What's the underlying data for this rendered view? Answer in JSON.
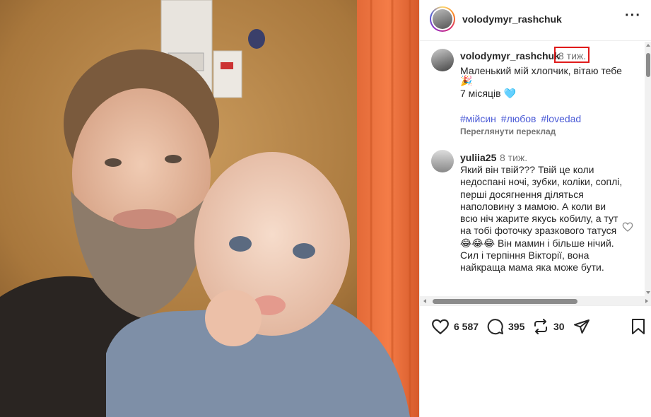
{
  "post": {
    "username": "volodymyr_rashchuk",
    "more_icon": "more-horizontal-icon"
  },
  "caption": {
    "username": "volodymyr_rashchuk",
    "time": "8 тиж.",
    "text_line1": "Маленький мій хлопчик, вітаю тебе",
    "emoji": "🎉",
    "text_line2": "7 місяців 🩵",
    "hashtags": [
      "#мійсин",
      "#любов",
      "#lovedad"
    ],
    "translate_label": "Переглянути переклад"
  },
  "comment": {
    "username": "yuliia25",
    "time": "8 тиж.",
    "text": "Який він твій??? Твій це коли недоспані ночі, зубки, коліки, соплі, перші досягнення діляться наполовину з мамою. А коли ви всю ніч жарите якусь кобилу, а тут на тобі фоточку зразкового татуся😂😂😂 Він мамин і більше нічий. Сил і терпіння Вікторії, вона найкраща мама яка може бути."
  },
  "actions": {
    "likes": "6 587",
    "comments": "395",
    "reposts": "30"
  },
  "colors": {
    "hashtag": "#4a5ad6",
    "highlight_box": "#e01b1b",
    "muted": "#737373"
  }
}
